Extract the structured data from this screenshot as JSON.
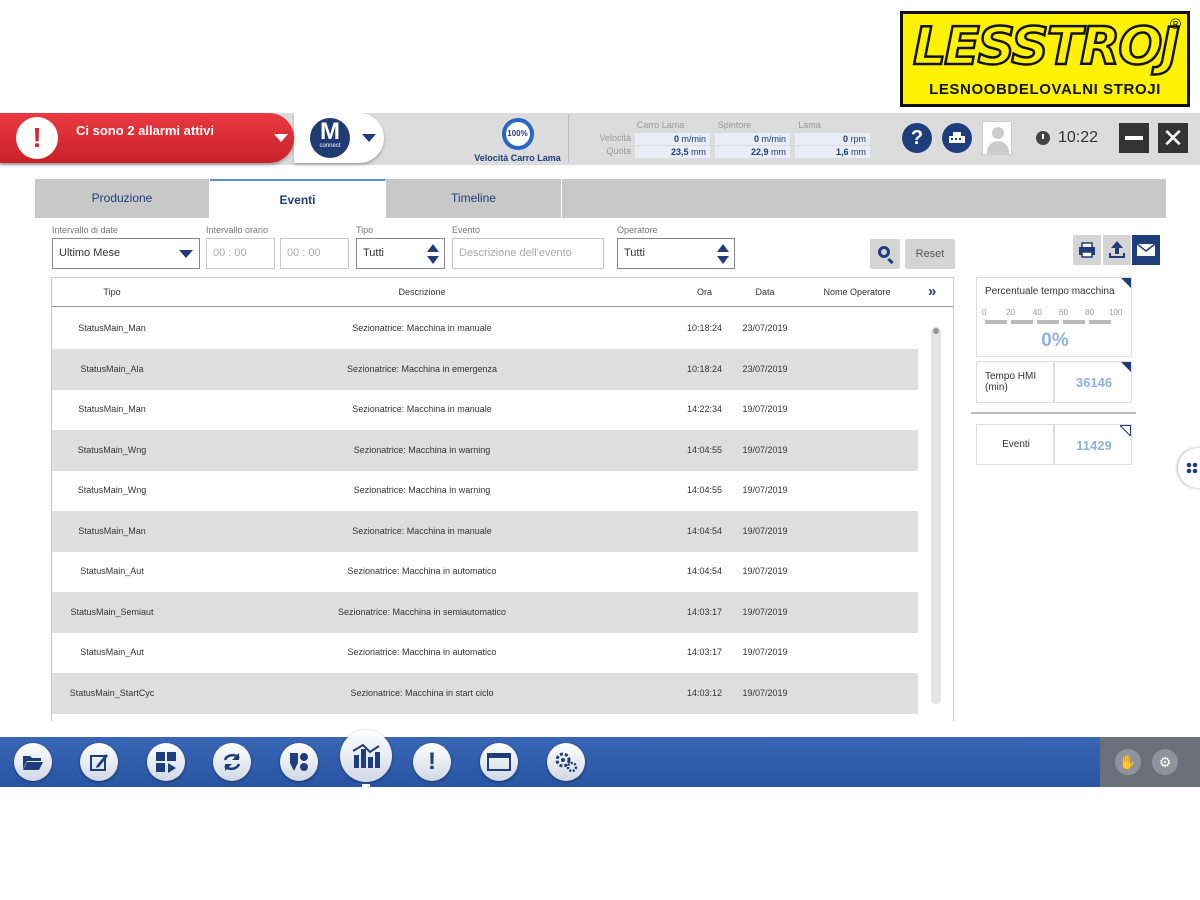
{
  "logo": {
    "main": "LESSTROJ",
    "reg": "®",
    "sub": "LESNOOBDELOVALNI STROJI"
  },
  "header": {
    "alarm_text": "Ci sono 2 allarmi attivi",
    "alarm_icon": "exclamation-icon",
    "connect_logo_letter": "M",
    "connect_logo_sub": "connect",
    "speed_percent": "100%",
    "speed_label": "Velocità Carro Lama",
    "param_rows": [
      "Velocità",
      "Quota"
    ],
    "param_cols": [
      "Carro Lama",
      "Spintore",
      "Lama"
    ],
    "param_values": [
      {
        "num": "0",
        "unit": "m/min"
      },
      {
        "num": "0",
        "unit": "m/min"
      },
      {
        "num": "0",
        "unit": "rpm"
      },
      {
        "num": "23,5",
        "unit": "mm"
      },
      {
        "num": "22,9",
        "unit": "mm"
      },
      {
        "num": "1,6",
        "unit": "mm"
      }
    ],
    "help_label": "?",
    "time": "10:22"
  },
  "tabs": [
    "Produzione",
    "Eventi",
    "Timeline"
  ],
  "active_tab": "Eventi",
  "filters": {
    "date_label": "Intervallo di date",
    "date_value": "Ultimo Mese",
    "time_label": "Intervallo orario",
    "time_from": "00 : 00",
    "time_to": "00 : 00",
    "type_label": "Tipo",
    "type_value": "Tutti",
    "event_label": "Evento",
    "event_placeholder": "Descrizione dell'evento",
    "operator_label": "Operatore",
    "operator_value": "Tutti",
    "reset_label": "Reset"
  },
  "table": {
    "headers": [
      "Tipo",
      "Descrizione",
      "Ora",
      "Data",
      "Nome Operatore"
    ],
    "rows": [
      [
        "StatusMain_Man",
        "Sezionatrice: Macchina in manuale",
        "10:18:24",
        "23/07/2019",
        ""
      ],
      [
        "StatusMain_Ala",
        "Sezionatrice: Macchina in emergenza",
        "10:18:24",
        "23/07/2019",
        ""
      ],
      [
        "StatusMain_Man",
        "Sezionatrice: Macchina in manuale",
        "14:22:34",
        "19/07/2019",
        ""
      ],
      [
        "StatusMain_Wng",
        "Sezionatrice: Macchina in warning",
        "14:04:55",
        "19/07/2019",
        ""
      ],
      [
        "StatusMain_Wng",
        "Sezionatrice: Macchina in warning",
        "14:04:55",
        "19/07/2019",
        ""
      ],
      [
        "StatusMain_Man",
        "Sezionatrice: Macchina in manuale",
        "14:04:54",
        "19/07/2019",
        ""
      ],
      [
        "StatusMain_Aut",
        "Sezionatrice: Macchina in automatico",
        "14:04:54",
        "19/07/2019",
        ""
      ],
      [
        "StatusMain_Semiaut",
        "Sezionatrice: Macchina in semiautomatico",
        "14:03:17",
        "19/07/2019",
        ""
      ],
      [
        "StatusMain_Aut",
        "Sezionatrice: Macchina in automatico",
        "14:03:17",
        "19/07/2019",
        ""
      ],
      [
        "StatusMain_StartCyc",
        "Sezionatrice: Macchina in start ciclo",
        "14:03:12",
        "19/07/2019",
        ""
      ]
    ]
  },
  "stats": {
    "machine_pct_title": "Percentuale tempo macchina",
    "scale": [
      "0",
      "20",
      "40",
      "60",
      "80",
      "100"
    ],
    "machine_pct_value": "0%",
    "hmi_label": "Tempo HMI (min)",
    "hmi_value": "36146",
    "events_label": "Eventi",
    "events_value": "11429"
  },
  "dock": {
    "icons": [
      "folder-icon",
      "edit-icon",
      "layout-play-icon",
      "sync-icon",
      "tools-icon",
      "chart-icon",
      "alert-icon",
      "window-icon",
      "gears-icon"
    ],
    "right_icons": [
      "hand-icon",
      "settings-icon"
    ]
  },
  "colors": {
    "navy": "#1f3d7a",
    "alarm_red": "#d42630",
    "dock_blue": "#2f5dac",
    "logo_yellow": "#fff200"
  }
}
